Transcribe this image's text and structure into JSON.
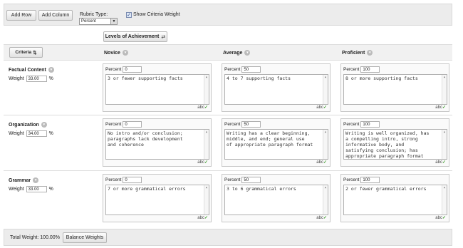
{
  "toolbar": {
    "add_row": "Add Row",
    "add_column": "Add Column",
    "rubric_type_label": "Rubric Type:",
    "rubric_type_value": "Percent",
    "show_weight_label": "Show Criteria Weight",
    "show_weight_checked": true
  },
  "levels_button": "Levels of Achievement",
  "criteria_header": "Criteria",
  "levels": [
    "Novice",
    "Average",
    "Proficient"
  ],
  "percent_label": "Percent",
  "weight_label": "Weight",
  "percent_sign": "%",
  "spellcheck_label": "abc",
  "criteria": [
    {
      "name": "Factual Content",
      "weight": "33.00",
      "cells": [
        {
          "percent": "0",
          "text": "3 or fewer supporting facts"
        },
        {
          "percent": "50",
          "text": "4 to 7 supporting facts"
        },
        {
          "percent": "100",
          "text": "8 or more supporting facts"
        }
      ]
    },
    {
      "name": "Organization",
      "weight": "34.00",
      "cells": [
        {
          "percent": "0",
          "text": "No intro and/or conclusion;\nparagraphs lack development\nand coherence"
        },
        {
          "percent": "50",
          "text": "Writing has a clear beginning,\nmiddle, and end; general use\nof appropriate paragraph format"
        },
        {
          "percent": "100",
          "text": "Writing is well organized, has\na compelling intro, strong\ninformative body, and\nsatisfying conclusion; has\nappropriate paragraph format"
        }
      ]
    },
    {
      "name": "Grammar",
      "weight": "33.00",
      "cells": [
        {
          "percent": "0",
          "text": "7 or more grammatical errors"
        },
        {
          "percent": "50",
          "text": "3 to 6 grammatical errors"
        },
        {
          "percent": "100",
          "text": "2 or fewer grammatical errors"
        }
      ]
    }
  ],
  "footer": {
    "total_weight_label": "Total Weight: 100.00%",
    "balance_button": "Balance Weights"
  }
}
